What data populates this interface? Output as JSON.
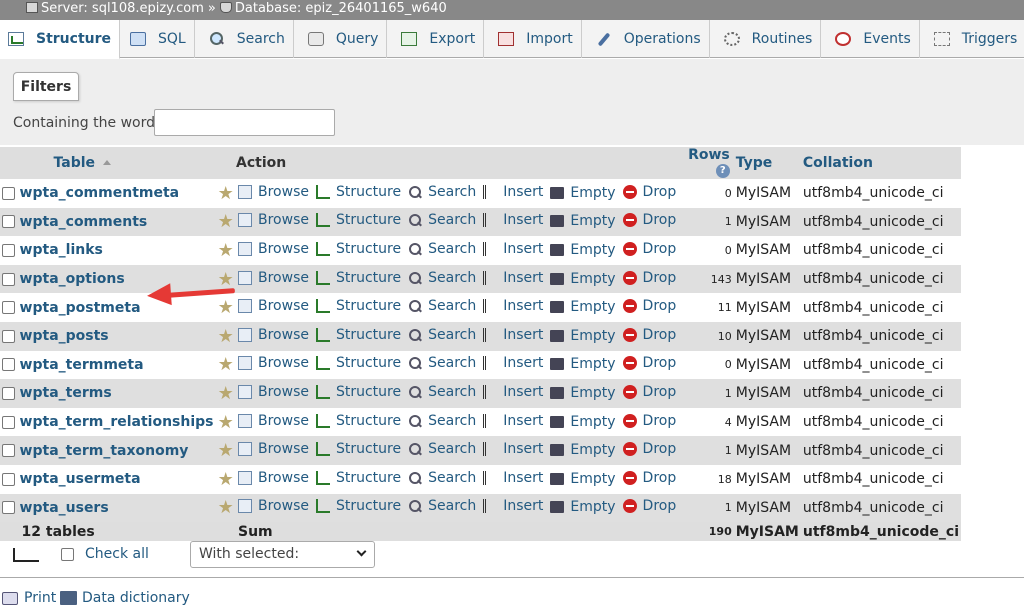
{
  "breadcrumb": {
    "server_label": "Server: sql108.epizy.com",
    "separator": "»",
    "database_label": "Database: epiz_26401165_w640"
  },
  "tabs": [
    {
      "label": "Structure",
      "icon": "structure-icon",
      "active": true
    },
    {
      "label": "SQL",
      "icon": "sql-icon"
    },
    {
      "label": "Search",
      "icon": "search-icon"
    },
    {
      "label": "Query",
      "icon": "query-icon"
    },
    {
      "label": "Export",
      "icon": "export-icon"
    },
    {
      "label": "Import",
      "icon": "import-icon"
    },
    {
      "label": "Operations",
      "icon": "wrench-icon"
    },
    {
      "label": "Routines",
      "icon": "routines-icon"
    },
    {
      "label": "Events",
      "icon": "clock-icon"
    },
    {
      "label": "Triggers",
      "icon": "triggers-icon"
    }
  ],
  "filters": {
    "title": "Filters",
    "label": "Containing the word:",
    "value": ""
  },
  "table": {
    "headers": {
      "table": "Table",
      "action": "Action",
      "rows": "Rows",
      "type": "Type",
      "collation": "Collation"
    },
    "actions": [
      "Browse",
      "Structure",
      "Search",
      "Insert",
      "Empty",
      "Drop"
    ],
    "rows": [
      {
        "name": "wpta_commentmeta",
        "rows": "0",
        "type": "MyISAM",
        "collation": "utf8mb4_unicode_ci"
      },
      {
        "name": "wpta_comments",
        "rows": "1",
        "type": "MyISAM",
        "collation": "utf8mb4_unicode_ci"
      },
      {
        "name": "wpta_links",
        "rows": "0",
        "type": "MyISAM",
        "collation": "utf8mb4_unicode_ci"
      },
      {
        "name": "wpta_options",
        "rows": "143",
        "type": "MyISAM",
        "collation": "utf8mb4_unicode_ci"
      },
      {
        "name": "wpta_postmeta",
        "rows": "11",
        "type": "MyISAM",
        "collation": "utf8mb4_unicode_ci"
      },
      {
        "name": "wpta_posts",
        "rows": "10",
        "type": "MyISAM",
        "collation": "utf8mb4_unicode_ci"
      },
      {
        "name": "wpta_termmeta",
        "rows": "0",
        "type": "MyISAM",
        "collation": "utf8mb4_unicode_ci"
      },
      {
        "name": "wpta_terms",
        "rows": "1",
        "type": "MyISAM",
        "collation": "utf8mb4_unicode_ci"
      },
      {
        "name": "wpta_term_relationships",
        "rows": "4",
        "type": "MyISAM",
        "collation": "utf8mb4_unicode_ci"
      },
      {
        "name": "wpta_term_taxonomy",
        "rows": "1",
        "type": "MyISAM",
        "collation": "utf8mb4_unicode_ci"
      },
      {
        "name": "wpta_usermeta",
        "rows": "18",
        "type": "MyISAM",
        "collation": "utf8mb4_unicode_ci"
      },
      {
        "name": "wpta_users",
        "rows": "1",
        "type": "MyISAM",
        "collation": "utf8mb4_unicode_ci"
      }
    ],
    "summary": {
      "count": "12 tables",
      "label": "Sum",
      "rows": "190",
      "type": "MyISAM",
      "collation": "utf8mb4_unicode_ci"
    }
  },
  "bottom": {
    "check_all": "Check all",
    "with_selected": "With selected:",
    "print": "Print",
    "data_dictionary": "Data dictionary"
  },
  "colors": {
    "link": "#235a81",
    "annotation_arrow": "#e53935"
  }
}
